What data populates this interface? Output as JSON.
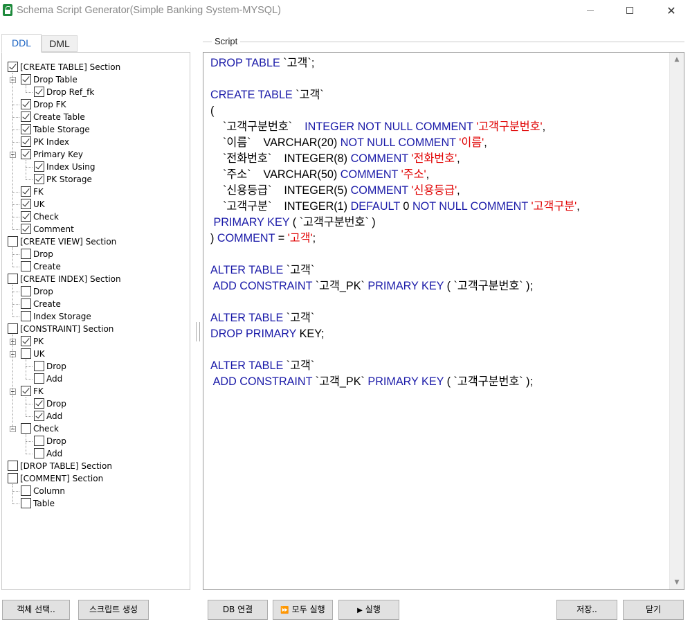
{
  "window": {
    "title": "Schema Script Generator(Simple Banking System-MYSQL)"
  },
  "tabs": [
    {
      "label": "DDL"
    },
    {
      "label": "DML"
    }
  ],
  "tree": {
    "items": [
      {
        "label": "[CREATE TABLE] Section",
        "level": 0,
        "checked": true
      },
      {
        "label": "Drop Table",
        "level": 1,
        "checked": true,
        "expander": "minus"
      },
      {
        "label": "Drop Ref_fk",
        "level": 2,
        "checked": true
      },
      {
        "label": "Drop FK",
        "level": 1,
        "checked": true
      },
      {
        "label": "Create Table",
        "level": 1,
        "checked": true
      },
      {
        "label": "Table Storage",
        "level": 1,
        "checked": true
      },
      {
        "label": "PK Index",
        "level": 1,
        "checked": true
      },
      {
        "label": "Primary Key",
        "level": 1,
        "checked": true,
        "expander": "minus"
      },
      {
        "label": "Index Using",
        "level": 2,
        "checked": true
      },
      {
        "label": "PK Storage",
        "level": 2,
        "checked": true
      },
      {
        "label": "FK",
        "level": 1,
        "checked": true
      },
      {
        "label": "UK",
        "level": 1,
        "checked": true
      },
      {
        "label": "Check",
        "level": 1,
        "checked": true
      },
      {
        "label": "Comment",
        "level": 1,
        "checked": true
      },
      {
        "label": "[CREATE VIEW] Section",
        "level": 0,
        "checked": false
      },
      {
        "label": "Drop",
        "level": 1,
        "checked": false
      },
      {
        "label": "Create",
        "level": 1,
        "checked": false
      },
      {
        "label": "[CREATE INDEX] Section",
        "level": 0,
        "checked": false
      },
      {
        "label": "Drop",
        "level": 1,
        "checked": false
      },
      {
        "label": "Create",
        "level": 1,
        "checked": false
      },
      {
        "label": "Index Storage",
        "level": 1,
        "checked": false
      },
      {
        "label": "[CONSTRAINT] Section",
        "level": 0,
        "checked": false
      },
      {
        "label": "PK",
        "level": 1,
        "checked": true,
        "expander": "plus"
      },
      {
        "label": "UK",
        "level": 1,
        "checked": false,
        "expander": "minus"
      },
      {
        "label": "Drop",
        "level": 2,
        "checked": false
      },
      {
        "label": "Add",
        "level": 2,
        "checked": false
      },
      {
        "label": "FK",
        "level": 1,
        "checked": true,
        "expander": "minus"
      },
      {
        "label": "Drop",
        "level": 2,
        "checked": true
      },
      {
        "label": "Add",
        "level": 2,
        "checked": true
      },
      {
        "label": "Check",
        "level": 1,
        "checked": false,
        "expander": "minus"
      },
      {
        "label": "Drop",
        "level": 2,
        "checked": false
      },
      {
        "label": "Add",
        "level": 2,
        "checked": false
      },
      {
        "label": "[DROP TABLE] Section",
        "level": 0,
        "checked": false
      },
      {
        "label": "[COMMENT] Section",
        "level": 0,
        "checked": false
      },
      {
        "label": "Column",
        "level": 1,
        "checked": false
      },
      {
        "label": "Table",
        "level": 1,
        "checked": false
      }
    ]
  },
  "script": {
    "label": "Script",
    "lines": [
      [
        {
          "t": "DROP TABLE",
          "c": "kw"
        },
        {
          "t": " `고객`;"
        }
      ],
      [],
      [
        {
          "t": "CREATE TABLE",
          "c": "kw"
        },
        {
          "t": " `고객`"
        }
      ],
      [
        {
          "t": "("
        }
      ],
      [
        {
          "t": "    `고객구분번호`    "
        },
        {
          "t": "INTEGER NOT NULL COMMENT",
          "c": "kw"
        },
        {
          "t": " "
        },
        {
          "t": "'고객구분번호'",
          "c": "str"
        },
        {
          "t": ","
        }
      ],
      [
        {
          "t": "    `이름`    VARCHAR(20) "
        },
        {
          "t": "NOT NULL COMMENT",
          "c": "kw"
        },
        {
          "t": " "
        },
        {
          "t": "'이름'",
          "c": "str"
        },
        {
          "t": ","
        }
      ],
      [
        {
          "t": "    `전화번호`    INTEGER(8) "
        },
        {
          "t": "COMMENT",
          "c": "kw"
        },
        {
          "t": " "
        },
        {
          "t": "'전화번호'",
          "c": "str"
        },
        {
          "t": ","
        }
      ],
      [
        {
          "t": "    `주소`    VARCHAR(50) "
        },
        {
          "t": "COMMENT",
          "c": "kw"
        },
        {
          "t": " "
        },
        {
          "t": "'주소'",
          "c": "str"
        },
        {
          "t": ","
        }
      ],
      [
        {
          "t": "    `신용등급`    INTEGER(5) "
        },
        {
          "t": "COMMENT",
          "c": "kw"
        },
        {
          "t": " "
        },
        {
          "t": "'신용등급'",
          "c": "str"
        },
        {
          "t": ","
        }
      ],
      [
        {
          "t": "    `고객구분`    INTEGER(1) "
        },
        {
          "t": "DEFAULT",
          "c": "kw"
        },
        {
          "t": " 0 "
        },
        {
          "t": "NOT NULL COMMENT",
          "c": "kw"
        },
        {
          "t": " "
        },
        {
          "t": "'고객구분'",
          "c": "str"
        },
        {
          "t": ","
        }
      ],
      [
        {
          "t": " "
        },
        {
          "t": "PRIMARY KEY",
          "c": "kw"
        },
        {
          "t": " ( `고객구분번호` )"
        }
      ],
      [
        {
          "t": ") "
        },
        {
          "t": "COMMENT",
          "c": "kw"
        },
        {
          "t": " = "
        },
        {
          "t": "'고객'",
          "c": "str"
        },
        {
          "t": ";"
        }
      ],
      [],
      [
        {
          "t": "ALTER TABLE",
          "c": "kw"
        },
        {
          "t": " `고객`"
        }
      ],
      [
        {
          "t": " "
        },
        {
          "t": "ADD CONSTRAINT",
          "c": "kw"
        },
        {
          "t": " `고객_PK` "
        },
        {
          "t": "PRIMARY KEY",
          "c": "kw"
        },
        {
          "t": " ( `고객구분번호` );"
        }
      ],
      [],
      [
        {
          "t": "ALTER TABLE",
          "c": "kw"
        },
        {
          "t": " `고객`"
        }
      ],
      [
        {
          "t": "DROP PRIMARY",
          "c": "kw"
        },
        {
          "t": " KEY;"
        }
      ],
      [],
      [
        {
          "t": "ALTER TABLE",
          "c": "kw"
        },
        {
          "t": " `고객`"
        }
      ],
      [
        {
          "t": " "
        },
        {
          "t": "ADD CONSTRAINT",
          "c": "kw"
        },
        {
          "t": " `고객_PK` "
        },
        {
          "t": "PRIMARY KEY",
          "c": "kw"
        },
        {
          "t": " ( `고객구분번호` );"
        }
      ]
    ]
  },
  "buttons": {
    "select_objects": "객체 선택..",
    "generate_script": "스크립트 생성",
    "db_connect": "DB 연결",
    "run_all": "모두 실행",
    "run": "실행",
    "save": "저장..",
    "close": "닫기"
  },
  "icons": {
    "run_all": "fast-forward-icon",
    "run": "play-icon"
  },
  "colors": {
    "keyword": "#1a1aa8",
    "string": "#e00000",
    "tab_active": "#1a63c4"
  }
}
